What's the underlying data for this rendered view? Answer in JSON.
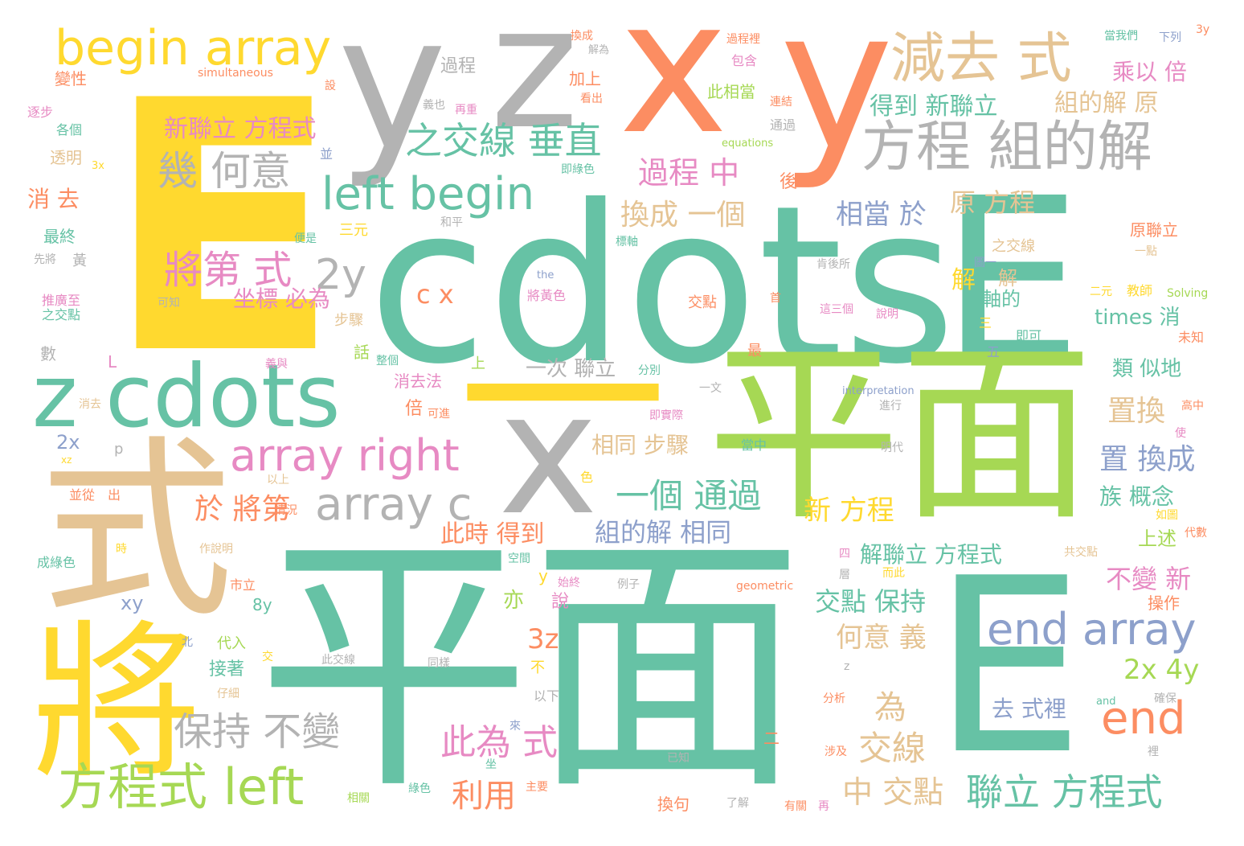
{
  "palette": {
    "teal": "#66c2a5",
    "orange": "#fc8d62",
    "blue": "#8da0cb",
    "pink": "#e78ac3",
    "green": "#a6d854",
    "yellow": "#ffd92f",
    "tan": "#e5c494",
    "gray": "#b3b3b3"
  },
  "words": [
    "E",
    "cdots",
    "E",
    "E",
    "平面",
    "平面",
    "式",
    "將",
    "y",
    "z",
    "x",
    "y",
    "x",
    "一",
    "z cdots",
    "begin array",
    "減去 式",
    "方程 組的解",
    "幾 何意",
    "left begin",
    "之交線 垂直",
    "2y",
    "將第 式",
    "array right",
    "array c",
    "方程式 left",
    "保持 不變",
    "end array",
    "end",
    "新聯立 方程式",
    "過程 中",
    "換成 一個",
    "相當 於",
    "原 方程",
    "得到 新聯立",
    "組的解 原",
    "乘以 倍",
    "過程",
    "變性",
    "加上",
    "此相當",
    "c x",
    "坐標 必為",
    "軸的",
    "times 消",
    "一次 聯立",
    "類 似地",
    "置換",
    "置 換成",
    "相同 步驟",
    "一個 通過",
    "於 將第",
    "新 方程",
    "族 概念",
    "組的解 相同",
    "此時 得到",
    "解聯立 方程式",
    "不變 新",
    "交點 保持",
    "何意 義",
    "2x 4y",
    "3z",
    "為",
    "交線",
    "此為 式",
    "去 式裡",
    "利用",
    "中 交點",
    "聯立 方程式",
    "消 去",
    "最終",
    "黃",
    "推廣至",
    "之交點",
    "透明",
    "逐步",
    "各個",
    "simultaneous",
    "equations",
    "Solving",
    "the",
    "interpretation",
    "geometric",
    "and",
    "將黃色",
    "成綠色",
    "交點",
    "解",
    "2x",
    "xy",
    "8y",
    "y",
    "亦",
    "說",
    "接著",
    "代入",
    "上述",
    "操作",
    "解",
    "三元",
    "二元",
    "原聯立",
    "之交線",
    "3y",
    "下列",
    "當我們",
    "包含",
    "過程裡",
    "換成",
    "解為",
    "設",
    "看出",
    "再重",
    "義也",
    "連結",
    "通過",
    "即綠色",
    "後",
    "標軸",
    "和平",
    "便是",
    "先將",
    "可知",
    "數",
    "步驟",
    "話",
    "整個",
    "上",
    "分別",
    "消去法",
    "倍",
    "可進",
    "消去",
    "L",
    "p",
    "並從",
    "出",
    "以上",
    "情況",
    "時",
    "作說明",
    "市立",
    "北",
    "交",
    "仔細",
    "此交線",
    "同樣",
    "不",
    "以下",
    "來",
    "坐",
    "主要",
    "綠色",
    "相關",
    "換句",
    "了解",
    "有關",
    "再",
    "涉及",
    "已知",
    "二",
    "z",
    "分析",
    "確保",
    "裡",
    "而此",
    "共交點",
    "代數",
    "如圖",
    "使",
    "高中",
    "進行",
    "明代",
    "當中",
    "色",
    "空間",
    "始終",
    "例子",
    "四",
    "層",
    "一文",
    "即實際",
    "義與",
    "最",
    "三",
    "五",
    "即可",
    "未知",
    "說明",
    "這三個",
    "首",
    "圖一",
    "一點",
    "教師",
    "肯後所",
    "之交線",
    "並",
    "3x",
    "2x",
    "xz",
    "方程式",
    "消去",
    "平面",
    "垂直",
    "換成一",
    "乘以"
  ]
}
